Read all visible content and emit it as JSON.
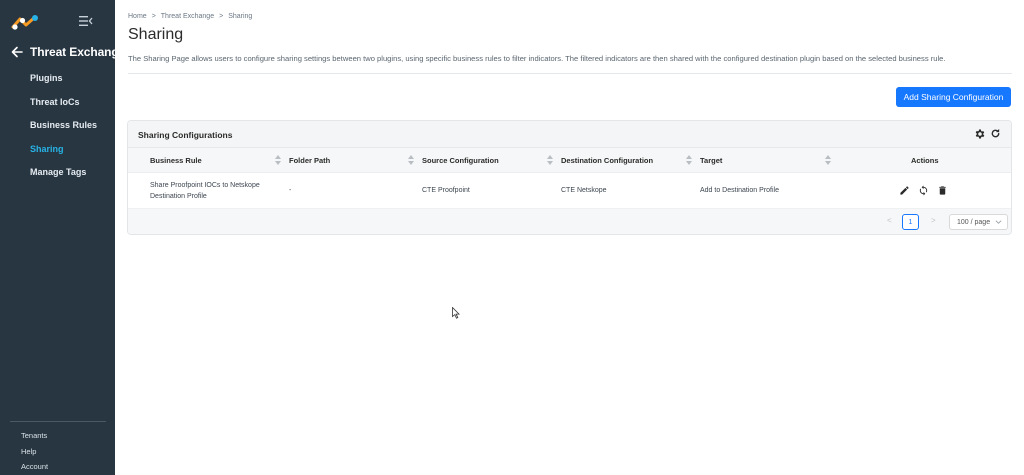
{
  "sidebar": {
    "back_label": "Threat Exchange",
    "items": [
      {
        "label": "Plugins",
        "active": false
      },
      {
        "label": "Threat IoCs",
        "active": false
      },
      {
        "label": "Business Rules",
        "active": false
      },
      {
        "label": "Sharing",
        "active": true
      },
      {
        "label": "Manage Tags",
        "active": false
      }
    ],
    "bottom_items": [
      "Tenants",
      "Help",
      "Account"
    ],
    "accent_color": "#27b3e6"
  },
  "breadcrumb": [
    "Home",
    ">",
    "Threat Exchange",
    ">",
    "Sharing"
  ],
  "page": {
    "title": "Sharing",
    "description": "The Sharing Page allows users to configure sharing settings between two plugins, using specific business rules to filter indicators. The filtered indicators are then shared with the configured destination plugin based on the selected business rule."
  },
  "add_button_label": "Add Sharing Configuration",
  "table": {
    "title": "Sharing Configurations",
    "columns": [
      "Business Rule",
      "Folder Path",
      "Source Configuration",
      "Destination Configuration",
      "Target",
      "Actions"
    ],
    "rows": [
      {
        "business_rule_line1": "Share Proofpoint IOCs to Netskope",
        "business_rule_line2": "Destination Profile",
        "folder_path": "-",
        "source": "CTE Proofpoint",
        "destination": "CTE Netskope",
        "target": "Add to Destination Profile"
      }
    ]
  },
  "pagination": {
    "prev": "<",
    "current": "1",
    "next": ">",
    "page_size": "100 / page"
  },
  "icons": {
    "edit": "pencil-icon",
    "sync": "sync-icon",
    "delete": "trash-icon",
    "settings": "gear-icon",
    "reload": "refresh-icon"
  },
  "colors": {
    "primary": "#1677ff",
    "sidebar_bg": "#283642"
  }
}
